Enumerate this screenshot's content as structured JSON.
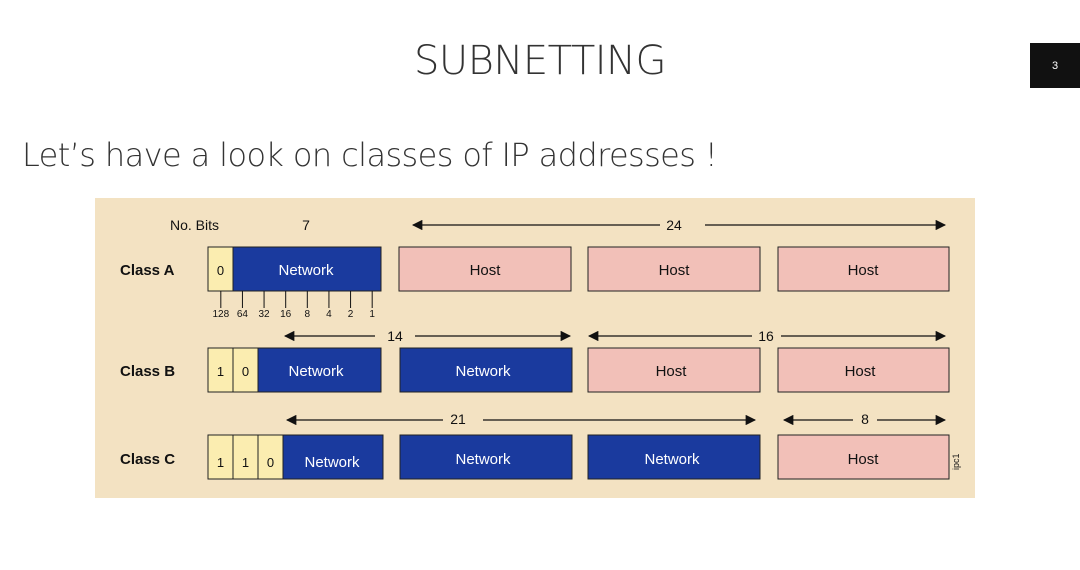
{
  "slide": {
    "title": "SUBNETTING",
    "page_number": "3",
    "subtitle": "Let’s have a look on classes of IP addresses !"
  },
  "diagram": {
    "no_bits_label": "No. Bits",
    "class_a": {
      "label": "Class A",
      "lead_bits": [
        "0"
      ],
      "network_bits": "7",
      "host_bits": "24",
      "octets": [
        "Network",
        "Host",
        "Host",
        "Host"
      ],
      "bit_values": [
        "128",
        "64",
        "32",
        "16",
        "8",
        "4",
        "2",
        "1"
      ]
    },
    "class_b": {
      "label": "Class B",
      "lead_bits": [
        "1",
        "0"
      ],
      "network_bits": "14",
      "host_bits": "16",
      "octets": [
        "Network",
        "Network",
        "Host",
        "Host"
      ]
    },
    "class_c": {
      "label": "Class C",
      "lead_bits": [
        "1",
        "1",
        "0"
      ],
      "network_bits": "21",
      "host_bits": "8",
      "octets": [
        "Network",
        "Network",
        "Network",
        "Host"
      ]
    },
    "figure_code": "ipc1"
  },
  "colors": {
    "network": "#1a3a9e",
    "host": "#f2c0b8",
    "bit": "#fbedb0",
    "background": "#f3e2c2"
  }
}
